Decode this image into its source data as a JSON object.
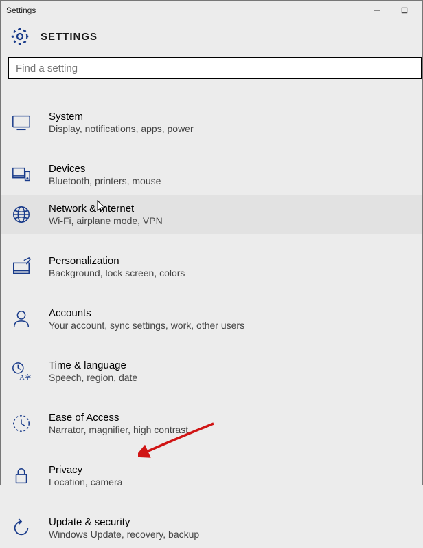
{
  "window": {
    "title": "Settings"
  },
  "header": {
    "label": "SETTINGS"
  },
  "search": {
    "placeholder": "Find a setting"
  },
  "categories": [
    {
      "title": "System",
      "desc": "Display, notifications, apps, power"
    },
    {
      "title": "Devices",
      "desc": "Bluetooth, printers, mouse"
    },
    {
      "title": "Network & Internet",
      "desc": "Wi-Fi, airplane mode, VPN"
    },
    {
      "title": "Personalization",
      "desc": "Background, lock screen, colors"
    },
    {
      "title": "Accounts",
      "desc": "Your account, sync settings, work, other users"
    },
    {
      "title": "Time & language",
      "desc": "Speech, region, date"
    },
    {
      "title": "Ease of Access",
      "desc": "Narrator, magnifier, high contrast"
    },
    {
      "title": "Privacy",
      "desc": "Location, camera"
    },
    {
      "title": "Update & security",
      "desc": "Windows Update, recovery, backup"
    }
  ],
  "icons": {
    "gear_color": "#193b8a",
    "category_color": "#193b8a"
  },
  "hovered_index": 2,
  "annotation": {
    "arrow_target": "Update & security",
    "arrow_color": "#d01414"
  }
}
